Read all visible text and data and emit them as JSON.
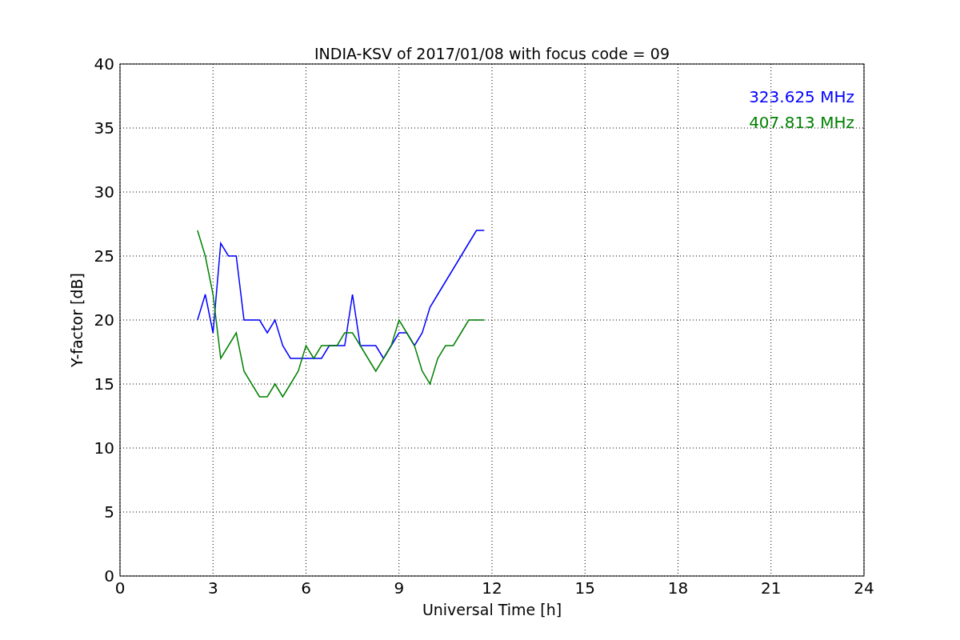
{
  "chart_data": {
    "type": "line",
    "title": "INDIA-KSV of 2017/01/08 with focus code = 09",
    "xlabel": "Universal Time [h]",
    "ylabel": "Y-factor [dB]",
    "x": [
      2.5,
      2.75,
      3.0,
      3.25,
      3.5,
      3.75,
      4.0,
      4.25,
      4.5,
      4.75,
      5.0,
      5.25,
      5.5,
      5.75,
      6.0,
      6.25,
      6.5,
      6.75,
      7.0,
      7.25,
      7.5,
      7.75,
      8.0,
      8.25,
      8.5,
      8.75,
      9.0,
      9.25,
      9.5,
      9.75,
      10.0,
      10.25,
      10.5,
      10.75,
      11.0,
      11.25,
      11.5,
      11.75
    ],
    "series": [
      {
        "name": "323.625 MHz",
        "color": "#0000ff",
        "values": [
          20,
          22,
          19,
          26,
          25,
          25,
          20,
          20,
          20,
          19,
          20,
          18,
          17,
          17,
          17,
          17,
          17,
          18,
          18,
          18,
          22,
          18,
          18,
          18,
          17,
          18,
          19,
          19,
          18,
          19,
          21,
          22,
          23,
          24,
          25,
          26,
          27,
          27
        ]
      },
      {
        "name": "407.813 MHz",
        "color": "#008000",
        "values": [
          27,
          25,
          22,
          17,
          18,
          19,
          16,
          15,
          14,
          14,
          15,
          14,
          15,
          16,
          18,
          17,
          18,
          18,
          18,
          19,
          19,
          18,
          17,
          16,
          17,
          18,
          20,
          19,
          18,
          16,
          15,
          17,
          18,
          18,
          19,
          20,
          20,
          20
        ]
      }
    ],
    "grid": true,
    "xlim": [
      0,
      24
    ],
    "ylim": [
      0,
      40
    ],
    "xticks": [
      0,
      3,
      6,
      9,
      12,
      15,
      18,
      21,
      24
    ],
    "yticks": [
      0,
      5,
      10,
      15,
      20,
      25,
      30,
      35,
      40
    ]
  }
}
